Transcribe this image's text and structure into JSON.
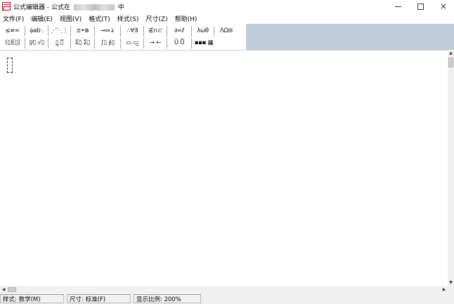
{
  "window": {
    "title_prefix": "公式编辑器 - 公式在",
    "title_suffix": "中",
    "buttons": {
      "minimize": "minimize-icon",
      "maximize": "maximize-icon",
      "close": "×"
    }
  },
  "menu": [
    {
      "label": "文件(F)"
    },
    {
      "label": "编辑(E)"
    },
    {
      "label": "视图(V)"
    },
    {
      "label": "格式(T)"
    },
    {
      "label": "样式(S)"
    },
    {
      "label": "尺寸(Z)"
    },
    {
      "label": "帮助(H)"
    }
  ],
  "toolbar": {
    "row1": [
      "≤≠≈",
      "ạ̇ab·.",
      "⋰⋱⋮",
      "±•⊗",
      "→⇔↓",
      "∴∀∃",
      "∉∩⊂",
      "∂∞ℓ",
      "λωθ",
      "ΛΩ⊛"
    ],
    "row2": [
      "(▯)[▯]",
      "▯⁄▯ √▯",
      "▯̲ ▯̅",
      "Σ▯ Σ▯",
      "∫▯ ∮▯",
      "▭ ▭̲",
      "→ ←",
      "Ū Ů",
      "▪▪▪ ▦"
    ]
  },
  "status": {
    "style": "样式: 数学(M)",
    "size": "尺寸: 标准(F)",
    "zoom": "显示比例: 200%"
  },
  "colors": {
    "toolbar_bg": "#bfcbd9",
    "statusbar_bg": "#f0f0f0",
    "icon_red": "#b00000"
  }
}
